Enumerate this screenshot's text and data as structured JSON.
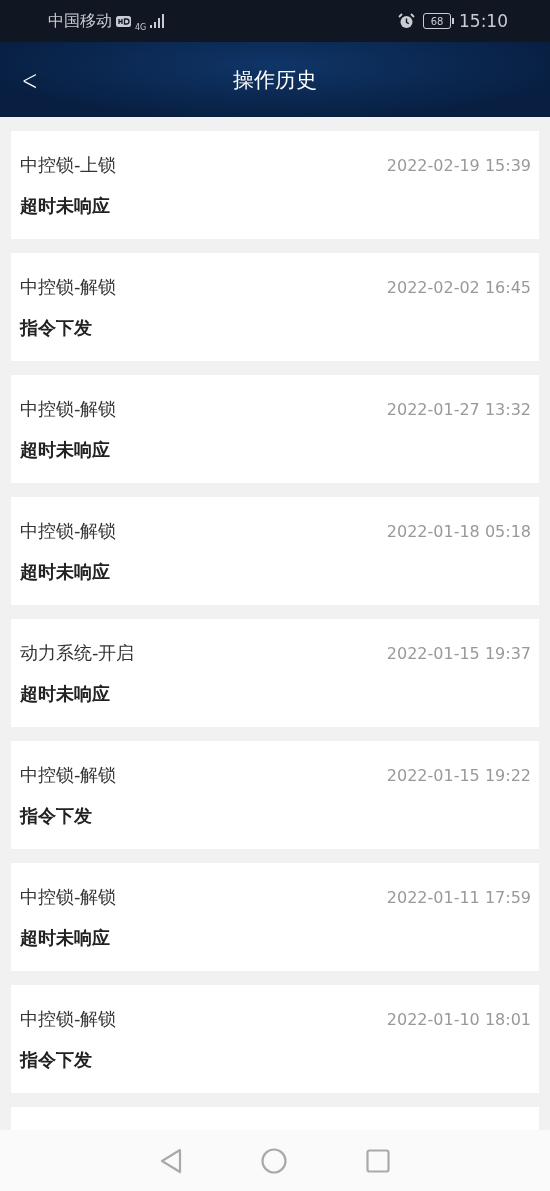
{
  "status_bar": {
    "carrier": "中国移动",
    "network": "4G",
    "battery": "68",
    "time": "15:10"
  },
  "header": {
    "back": "<",
    "title": "操作历史"
  },
  "records": [
    {
      "operation": "中控锁-上锁",
      "time": "2022-02-19 15:39",
      "result": "超时未响应"
    },
    {
      "operation": "中控锁-解锁",
      "time": "2022-02-02 16:45",
      "result": "指令下发"
    },
    {
      "operation": "中控锁-解锁",
      "time": "2022-01-27 13:32",
      "result": "超时未响应"
    },
    {
      "operation": "中控锁-解锁",
      "time": "2022-01-18 05:18",
      "result": "超时未响应"
    },
    {
      "operation": "动力系统-开启",
      "time": "2022-01-15 19:37",
      "result": "超时未响应"
    },
    {
      "operation": "中控锁-解锁",
      "time": "2022-01-15 19:22",
      "result": "指令下发"
    },
    {
      "operation": "中控锁-解锁",
      "time": "2022-01-11 17:59",
      "result": "超时未响应"
    },
    {
      "operation": "中控锁-解锁",
      "time": "2022-01-10 18:01",
      "result": "指令下发"
    }
  ]
}
